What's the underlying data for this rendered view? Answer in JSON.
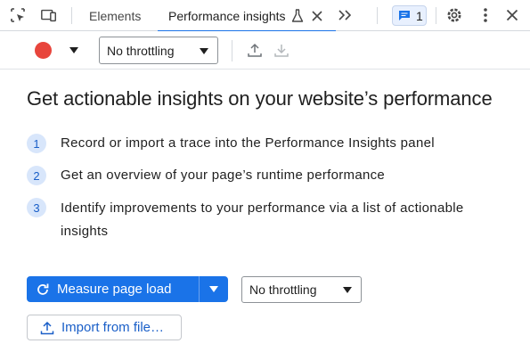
{
  "tabbar": {
    "tabs": [
      {
        "label": "Elements"
      },
      {
        "label": "Performance insights"
      }
    ],
    "issues_count": "1"
  },
  "toolbar": {
    "throttling_value": "No throttling"
  },
  "main": {
    "headline": "Get actionable insights on your website’s performance",
    "steps": [
      {
        "num": "1",
        "text": "Record or import a trace into the Performance Insights panel"
      },
      {
        "num": "2",
        "text": "Get an overview of your page’s runtime performance"
      },
      {
        "num": "3",
        "text": "Identify improvements to your performance via a list of actionable insights"
      }
    ],
    "measure_label": "Measure page load",
    "throttling_value": "No throttling",
    "import_label": "Import from file…"
  },
  "colors": {
    "accent": "#1a73e8",
    "record": "#e8453c",
    "step_badge_bg": "#d8e6fb"
  }
}
